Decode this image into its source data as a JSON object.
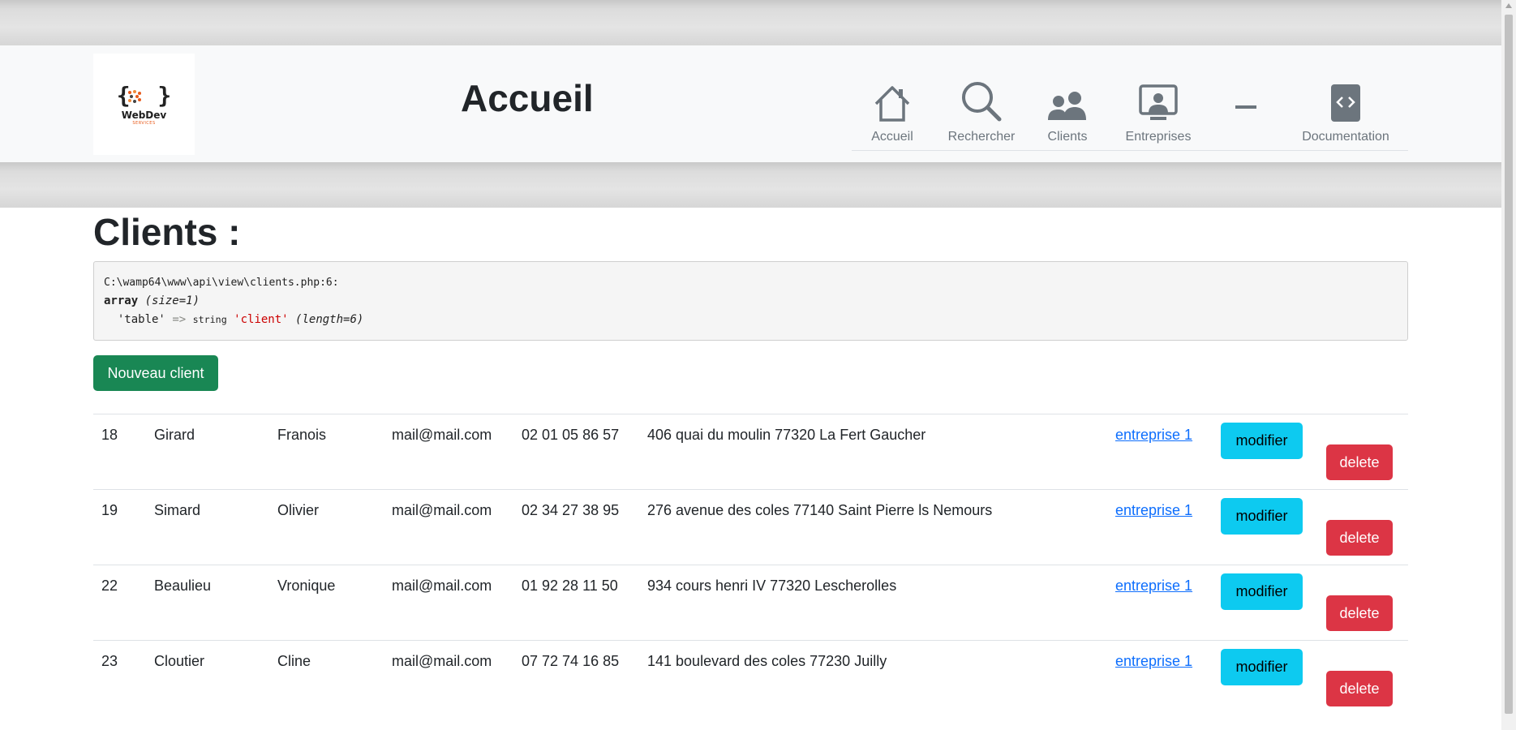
{
  "header": {
    "logo": {
      "name": "WebDev",
      "sub": "SERVICES"
    },
    "title": "Accueil",
    "nav": [
      {
        "label": "Accueil",
        "icon": "house-icon"
      },
      {
        "label": "Rechercher",
        "icon": "search-icon"
      },
      {
        "label": "Clients",
        "icon": "people-icon"
      },
      {
        "label": "Entreprises",
        "icon": "person-workspace-icon"
      },
      {
        "label": "",
        "icon": "dash-icon"
      },
      {
        "label": "Documentation",
        "icon": "code-square-icon"
      }
    ]
  },
  "main": {
    "title": "Clients :",
    "debug": {
      "path": "C:\\wamp64\\www\\api\\view\\clients.php:6:",
      "type": "array",
      "size": "(size=1)",
      "key": "'table'",
      "arrow": "=>",
      "valtype": "string",
      "value": "'client'",
      "length": "(length=6)"
    },
    "new_button": "Nouveau client",
    "modify_label": "modifier",
    "delete_label": "delete",
    "rows": [
      {
        "id": "18",
        "nom": "Girard",
        "prenom": "Franois",
        "mail": "mail@mail.com",
        "tel": "02 01 05 86 57",
        "adresse": "406 quai du moulin 77320 La Fert Gaucher",
        "entreprise": "entreprise 1"
      },
      {
        "id": "19",
        "nom": "Simard",
        "prenom": "Olivier",
        "mail": "mail@mail.com",
        "tel": "02 34 27 38 95",
        "adresse": "276 avenue des coles 77140 Saint Pierre ls Nemours",
        "entreprise": "entreprise 1"
      },
      {
        "id": "22",
        "nom": "Beaulieu",
        "prenom": "Vronique",
        "mail": "mail@mail.com",
        "tel": "01 92 28 11 50",
        "adresse": "934 cours henri IV 77320 Lescherolles",
        "entreprise": "entreprise 1"
      },
      {
        "id": "23",
        "nom": "Cloutier",
        "prenom": "Cline",
        "mail": "mail@mail.com",
        "tel": "07 72 74 16 85",
        "adresse": "141 boulevard des coles 77230 Juilly",
        "entreprise": "entreprise 1"
      }
    ]
  },
  "colors": {
    "success": "#198754",
    "info": "#0dcaf0",
    "danger": "#dc3545",
    "link": "#0d6efd",
    "nav_text": "#6c757d"
  }
}
